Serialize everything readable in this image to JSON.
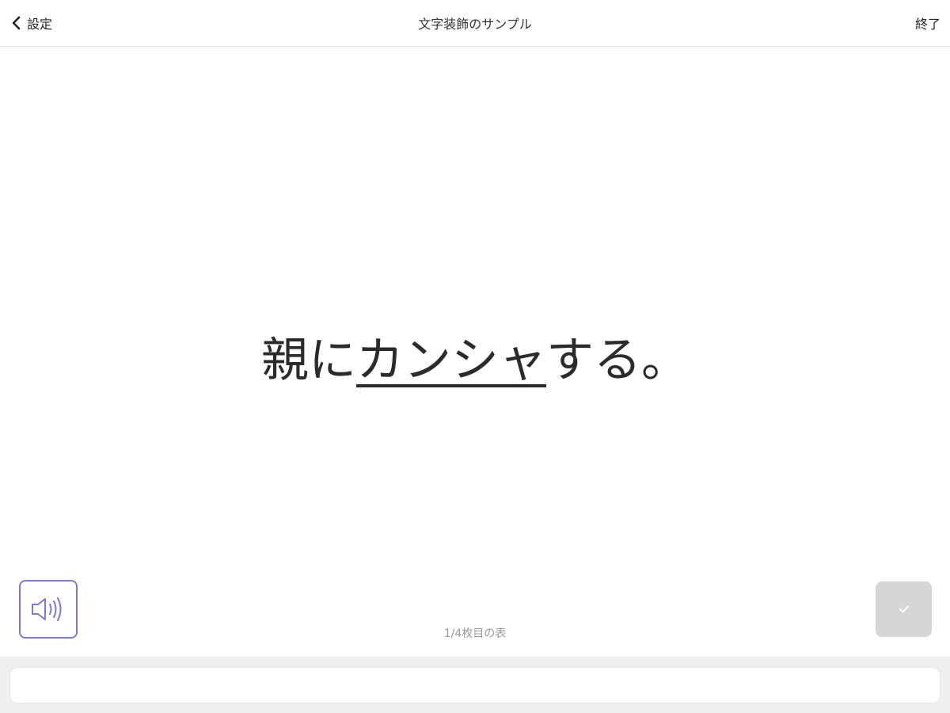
{
  "navbar": {
    "back_label": "設定",
    "title": "文字装飾のサンプル",
    "done_label": "終了"
  },
  "card": {
    "sentence_before": "親に",
    "sentence_underlined": "カンシャ",
    "sentence_after": "する。",
    "page_indicator": "1/4枚目の表"
  },
  "icons": {
    "back": "chevron-left-icon",
    "speaker": "speaker-icon",
    "check": "checkmark-icon"
  },
  "colors": {
    "speaker_accent": "#7c78d6",
    "check_button_bg": "#d6d6d6",
    "bottom_bar_bg": "#efefef"
  }
}
